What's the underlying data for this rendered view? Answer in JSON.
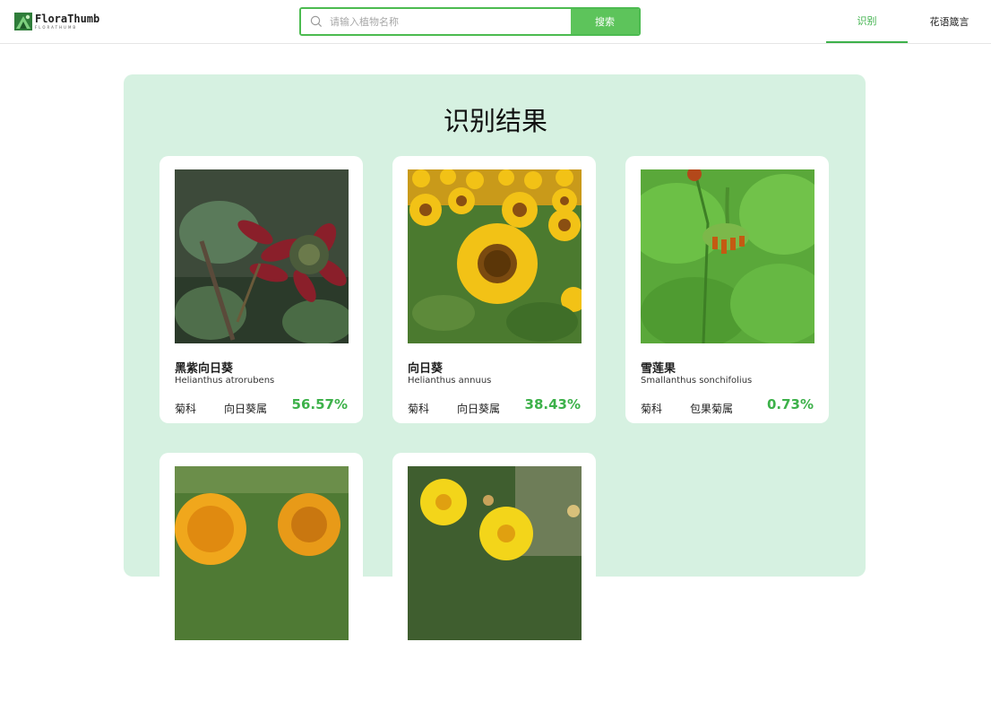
{
  "header": {
    "logo_name": "FloraThumb",
    "logo_sub": "FLORATHUMB",
    "search_placeholder": "请输入植物名称",
    "search_button": "搜索",
    "nav": [
      {
        "label": "识别",
        "active": true
      },
      {
        "label": "花语箴言",
        "active": false
      }
    ]
  },
  "colors": {
    "accent": "#3db14a",
    "button": "#5dc45b",
    "panel_bg": "#d6f1e1"
  },
  "result_title": "识别结果",
  "results": [
    {
      "name_cn": "黑紫向日葵",
      "name_latin": "Helianthus atrorubens",
      "family": "菊科",
      "genus": "向日葵属",
      "score": "56.57%"
    },
    {
      "name_cn": "向日葵",
      "name_latin": "Helianthus annuus",
      "family": "菊科",
      "genus": "向日葵属",
      "score": "38.43%"
    },
    {
      "name_cn": "雪莲果",
      "name_latin": "Smallanthus sonchifolius",
      "family": "菊科",
      "genus": "包果菊属",
      "score": "0.73%"
    },
    {
      "name_cn": "",
      "name_latin": "",
      "family": "",
      "genus": "",
      "score": ""
    },
    {
      "name_cn": "",
      "name_latin": "",
      "family": "",
      "genus": "",
      "score": ""
    }
  ]
}
